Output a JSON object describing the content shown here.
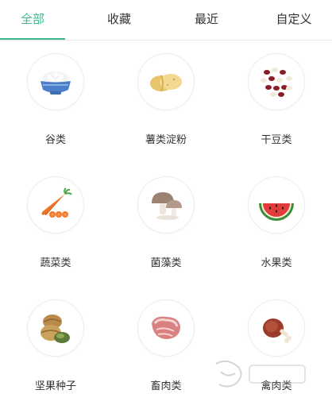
{
  "tabs": [
    {
      "label": "全部",
      "active": true
    },
    {
      "label": "收藏",
      "active": false
    },
    {
      "label": "最近",
      "active": false
    },
    {
      "label": "自定义",
      "active": false
    }
  ],
  "accent_color": "#3cba8c",
  "categories": [
    {
      "label": "谷类",
      "icon": "rice-bowl-icon"
    },
    {
      "label": "薯类淀粉",
      "icon": "potato-icon"
    },
    {
      "label": "干豆类",
      "icon": "beans-icon"
    },
    {
      "label": "蔬菜类",
      "icon": "carrot-icon"
    },
    {
      "label": "菌藻类",
      "icon": "mushroom-icon"
    },
    {
      "label": "水果类",
      "icon": "watermelon-icon"
    },
    {
      "label": "坚果种子",
      "icon": "nuts-icon"
    },
    {
      "label": "畜肉类",
      "icon": "meat-icon"
    },
    {
      "label": "禽肉类",
      "icon": "poultry-leg-icon"
    }
  ]
}
